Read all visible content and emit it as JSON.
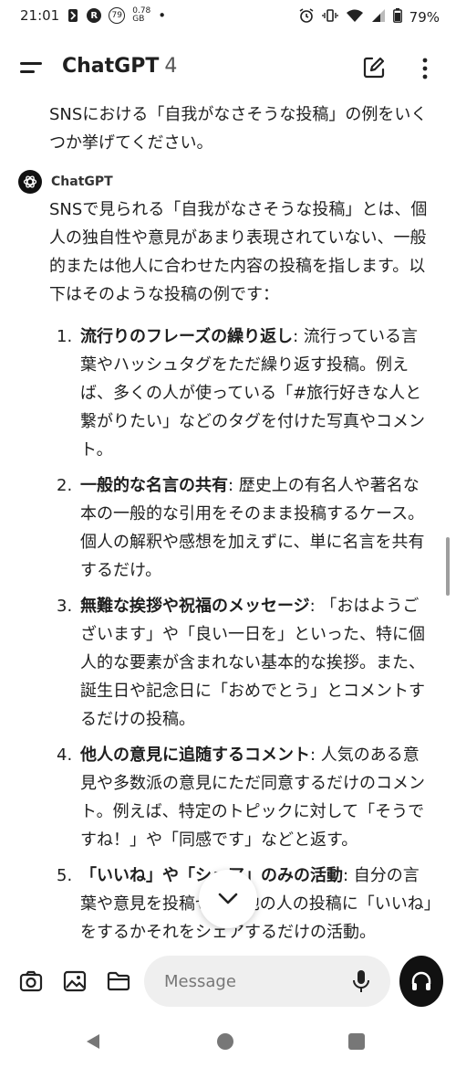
{
  "status_bar": {
    "time": "21:01",
    "notif_badge_r": "R",
    "notif_badge_79": "79",
    "net_rate_value": "0.78",
    "net_rate_unit": "GB",
    "dot": "•",
    "battery": "79%"
  },
  "header": {
    "title": "ChatGPT",
    "version": "4"
  },
  "chat": {
    "user_message": "SNSにおける「自我がなさそうな投稿」の例をいくつか挙げてください。",
    "assistant_name": "ChatGPT",
    "assistant_intro": "SNSで見られる「自我がなさそうな投稿」とは、個人の独自性や意見があまり表現されていない、一般的または他人に合わせた内容の投稿を指します。以下はそのような投稿の例です：",
    "examples": [
      {
        "num": "1.",
        "kw": "流行りのフレーズの繰り返し",
        "text": ": 流行っている言葉やハッシュタグをただ繰り返す投稿。例えば、多くの人が使っている「#旅行好きな人と繋がりたい」などのタグを付けた写真やコメント。"
      },
      {
        "num": "2.",
        "kw": "一般的な名言の共有",
        "text": ": 歴史上の有名人や著名な本の一般的な引用をそのまま投稿するケース。個人の解釈や感想を加えずに、単に名言を共有するだけ。"
      },
      {
        "num": "3.",
        "kw": "無難な挨拶や祝福のメッセージ",
        "text": ": 「おはようございます」や「良い一日を」といった、特に個人的な要素が含まれない基本的な挨拶。また、誕生日や記念日に「おめでとう」とコメントするだけの投稿。"
      },
      {
        "num": "4.",
        "kw": "他人の意見に追随するコメント",
        "text": ": 人気のある意見や多数派の意見にただ同意するだけのコメント。例えば、特定のトピックに対して「そうですね！」や「同感です」などと返す。"
      },
      {
        "num": "5.",
        "kw": "「いいね」や「シェア」のみの活動",
        "text": ": 自分の言葉や意見を投稿せず、他の人の投稿に「いいね」をするかそれをシェアするだけの活動。"
      }
    ]
  },
  "composer": {
    "placeholder": "Message"
  },
  "icons": {
    "menu": "menu-icon",
    "edit": "edit-icon",
    "more": "kebab-icon",
    "camera": "camera-icon",
    "image": "image-icon",
    "folder": "folder-icon",
    "mic": "mic-icon",
    "voice": "headphones-icon",
    "scroll_down": "chevron-down-icon"
  }
}
